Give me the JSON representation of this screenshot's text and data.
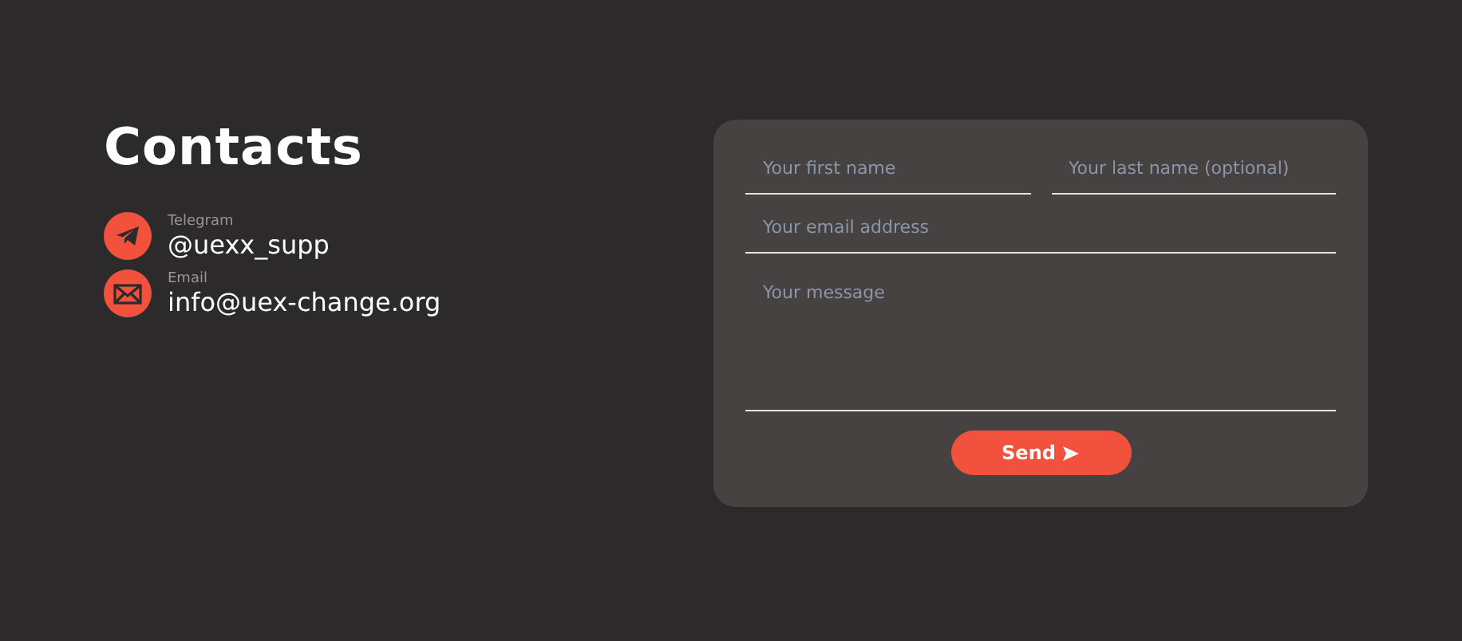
{
  "title": "Contacts",
  "contacts": [
    {
      "kind": "telegram",
      "label": "Telegram",
      "value": "@uexx_supp"
    },
    {
      "kind": "email",
      "label": "Email",
      "value": "info@uex-change.org"
    }
  ],
  "form": {
    "first_name": {
      "placeholder": "Your first name"
    },
    "last_name": {
      "placeholder": "Your last name (optional)"
    },
    "email": {
      "placeholder": "Your email address"
    },
    "message": {
      "placeholder": "Your message"
    },
    "send_button": {
      "label": "Send"
    }
  }
}
